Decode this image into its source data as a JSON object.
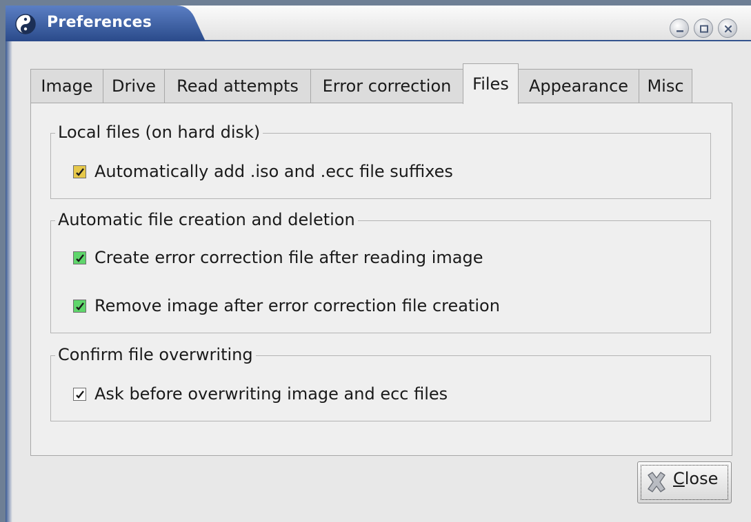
{
  "window": {
    "title": "Preferences",
    "controls": [
      "minimize-icon",
      "maximize-icon",
      "close-icon"
    ]
  },
  "tabs": [
    {
      "label": "Image",
      "active": false
    },
    {
      "label": "Drive",
      "active": false
    },
    {
      "label": "Read attempts",
      "active": false
    },
    {
      "label": "Error correction",
      "active": false
    },
    {
      "label": "Files",
      "active": true
    },
    {
      "label": "Appearance",
      "active": false
    },
    {
      "label": "Misc",
      "active": false
    }
  ],
  "files_page": {
    "local_files": {
      "title": "Local files (on hard disk)",
      "auto_suffix": {
        "label": "Automatically add .iso and .ecc file suffixes",
        "checked": true,
        "color": "#e6c84a"
      }
    },
    "auto_creation": {
      "title": "Automatic file creation and deletion",
      "create_ecc": {
        "label": "Create error correction file after reading image",
        "checked": true,
        "color": "#5fd66b"
      },
      "remove_image": {
        "label": "Remove image after error correction file creation",
        "checked": true,
        "color": "#5fd66b"
      }
    },
    "confirm_overwrite": {
      "title": "Confirm file overwriting",
      "ask_before": {
        "label": "Ask before overwriting image and ecc files",
        "checked": true,
        "color": "#ffffff"
      }
    }
  },
  "close_button": {
    "mnemonic": "C",
    "rest": "lose",
    "icon": "close-x-icon"
  }
}
